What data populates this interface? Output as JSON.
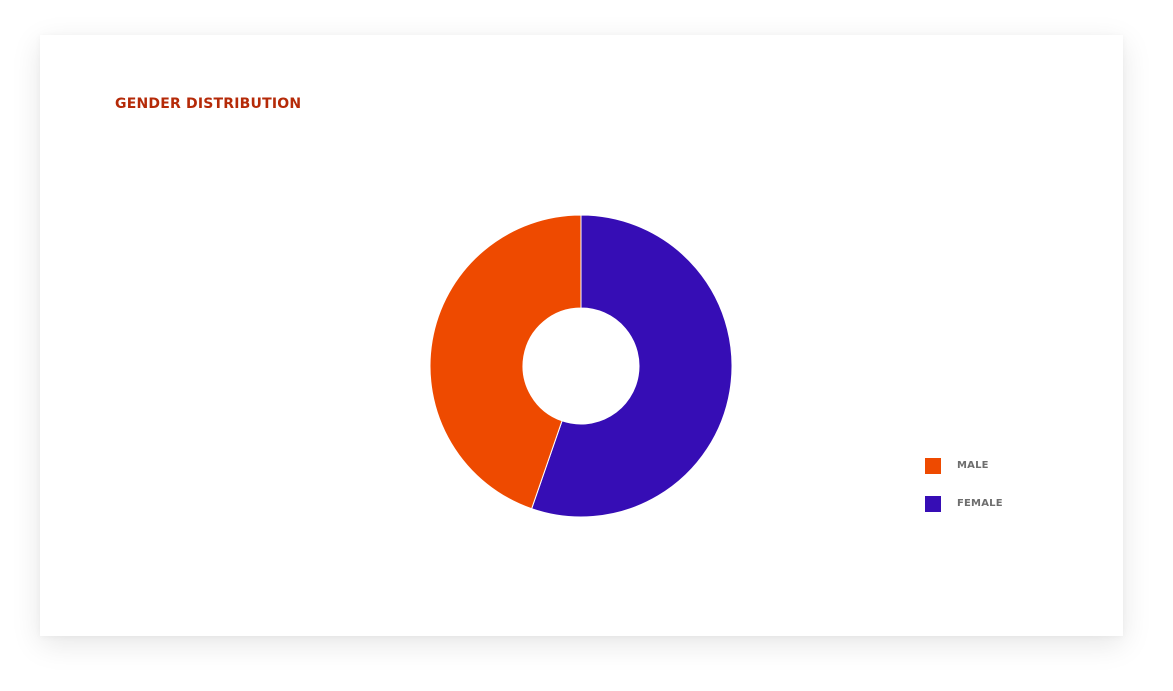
{
  "card": {
    "title": "GENDER DISTRIBUTION"
  },
  "colors": {
    "title": "#b52a08",
    "male": "#ee4a00",
    "female": "#360db5"
  },
  "chart_data": {
    "type": "pie",
    "variant": "donut",
    "title": "GENDER DISTRIBUTION",
    "categories": [
      "MALE",
      "FEMALE"
    ],
    "values": [
      44.7,
      55.3
    ],
    "colors": [
      "#ee4a00",
      "#360db5"
    ],
    "legend_position": "right",
    "legend": [
      {
        "label": "MALE",
        "color": "#ee4a00"
      },
      {
        "label": "FEMALE",
        "color": "#360db5"
      }
    ]
  }
}
